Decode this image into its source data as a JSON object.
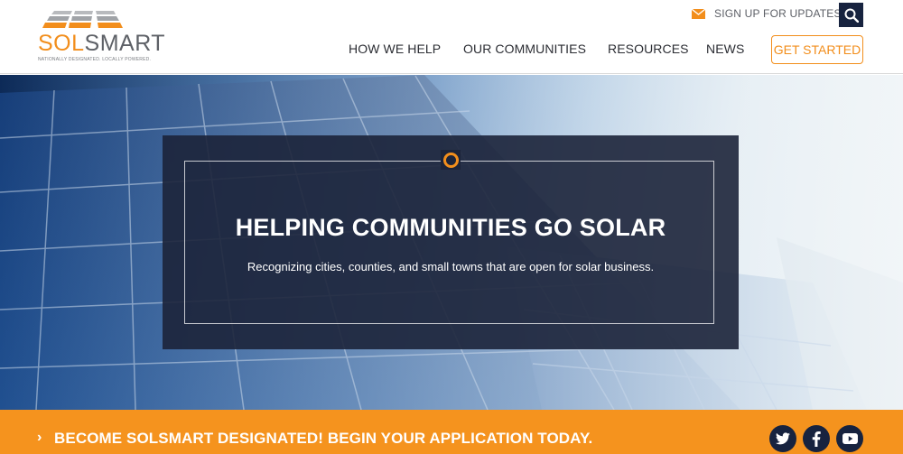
{
  "logo": {
    "sol": "SOL",
    "smart": "SMART",
    "tagline": "NATIONALLY DESIGNATED. LOCALLY POWERED."
  },
  "utility": {
    "signup_label": "SIGN UP FOR UPDATES",
    "signup_icon": "envelope-icon",
    "search_icon": "search-icon"
  },
  "nav": {
    "items": [
      {
        "label": "HOW WE HELP"
      },
      {
        "label": "OUR COMMUNITIES"
      },
      {
        "label": "RESOURCES"
      },
      {
        "label": "NEWS"
      }
    ],
    "cta_label": "GET STARTED"
  },
  "hero": {
    "title": "HELPING COMMUNITIES GO SOLAR",
    "subtitle": "Recognizing cities, counties, and small towns that are open for solar business."
  },
  "cta_bar": {
    "text": "BECOME SOLSMART DESIGNATED! BEGIN YOUR APPLICATION TODAY.",
    "chevron_icon": "chevron-right-icon"
  },
  "social": [
    {
      "name": "twitter-icon",
      "glyph": "t"
    },
    {
      "name": "facebook-icon",
      "glyph": "f"
    },
    {
      "name": "youtube-icon",
      "glyph": "▶"
    }
  ],
  "colors": {
    "accent_orange": "#f28e1c",
    "navy": "#17233f",
    "cta_bar": "#f5931e"
  }
}
